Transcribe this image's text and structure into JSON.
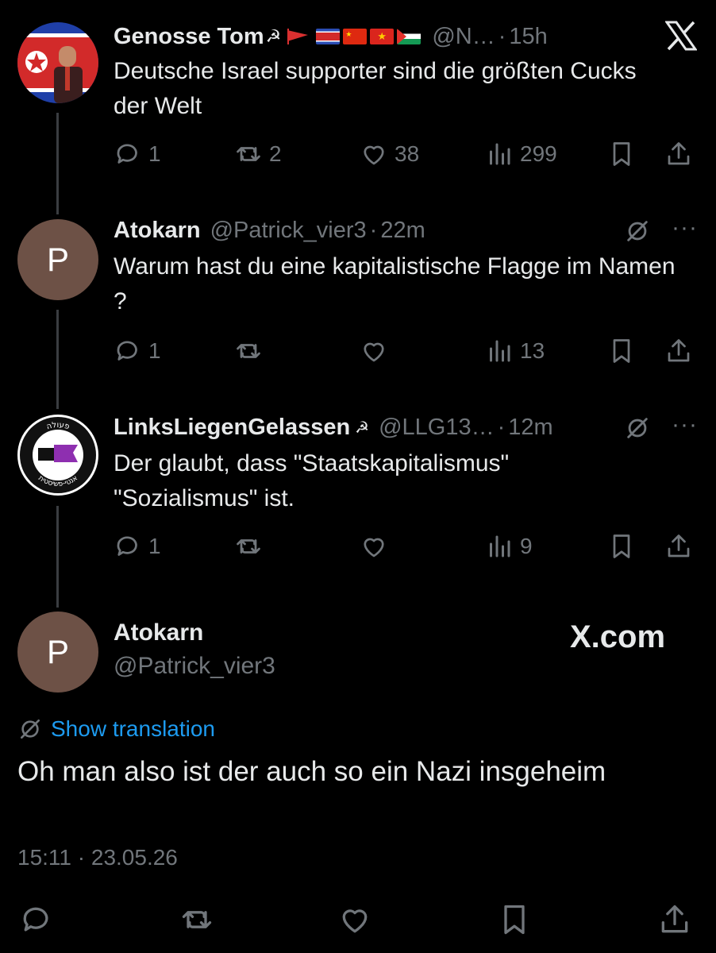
{
  "brand": {
    "watermark": "X.com"
  },
  "tweets": [
    {
      "name": "Genosse Tom",
      "handle": "@N…",
      "time": "15h",
      "text": "Deutsche Israel supporter sind die größten Cucks der Welt",
      "replies": "1",
      "reposts": "2",
      "likes": "38",
      "views": "299"
    },
    {
      "avatar_letter": "P",
      "name": "Atokarn",
      "handle": "@Patrick_vier3",
      "time": "22m",
      "text": "Warum hast du eine kapitalistische Flagge im Namen ?",
      "replies": "1",
      "reposts": "",
      "likes": "",
      "views": "13"
    },
    {
      "avatar_text": "אנטי-פשיסטית",
      "avatar_top_text": "פעולה",
      "name": "LinksLiegenGelassen",
      "handle": "@LLG13…",
      "time": "12m",
      "text": "Der glaubt, dass \"Staatskapitalismus\" \"Sozialismus\" ist.",
      "replies": "1",
      "reposts": "",
      "likes": "",
      "views": "9"
    }
  ],
  "main": {
    "avatar_letter": "P",
    "name": "Atokarn",
    "handle": "@Patrick_vier3",
    "show_translation": "Show translation",
    "text": "Oh man also ist der auch so ein Nazi insgeheim",
    "timestamp": "15:11 · 23.05.26"
  },
  "symbols": {
    "dot": "·",
    "hammer_sickle": "☭"
  },
  "colors": {
    "background": "#000000",
    "text": "#e7e9ea",
    "muted": "#71767b",
    "link": "#1d9bf0",
    "avatar": "#6d5146"
  }
}
